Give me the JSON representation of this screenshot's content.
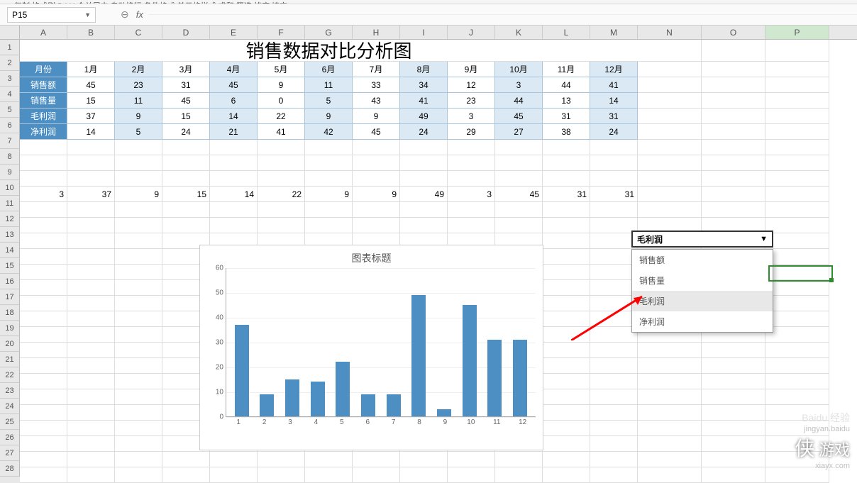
{
  "toolbar_fragments": "复制 格式刷 B I U 合并居中 自动换行 条件格式 单元格样式 求和 筛选 排序 填充",
  "name_box": "P15",
  "fx_label": "fx",
  "title": "销售数据对比分析图",
  "columns": [
    "A",
    "B",
    "C",
    "D",
    "E",
    "F",
    "G",
    "H",
    "I",
    "J",
    "K",
    "L",
    "M",
    "N",
    "O",
    "P"
  ],
  "row_labels": [
    "月份",
    "销售额",
    "销售量",
    "毛利润",
    "净利润"
  ],
  "months": [
    "1月",
    "2月",
    "3月",
    "4月",
    "5月",
    "6月",
    "7月",
    "8月",
    "9月",
    "10月",
    "11月",
    "12月"
  ],
  "data_rows": {
    "销售额": [
      45,
      23,
      31,
      45,
      9,
      11,
      33,
      34,
      12,
      3,
      44,
      41
    ],
    "销售量": [
      15,
      11,
      45,
      6,
      0,
      5,
      43,
      41,
      23,
      44,
      13,
      14
    ],
    "毛利润": [
      37,
      9,
      15,
      14,
      22,
      9,
      9,
      49,
      3,
      45,
      31,
      31
    ],
    "净利润": [
      14,
      5,
      24,
      21,
      41,
      42,
      45,
      24,
      29,
      27,
      38,
      24
    ]
  },
  "echo_row_prefix": 3,
  "echo_row": [
    37,
    9,
    15,
    14,
    22,
    9,
    9,
    49,
    3,
    45,
    31,
    31
  ],
  "dropdown": {
    "selected": "毛利润",
    "options": [
      "销售额",
      "销售量",
      "毛利润",
      "净利润"
    ],
    "highlight_index": 2
  },
  "chart_data": {
    "type": "bar",
    "title": "图表标题",
    "categories": [
      1,
      2,
      3,
      4,
      5,
      6,
      7,
      8,
      9,
      10,
      11,
      12
    ],
    "values": [
      37,
      9,
      15,
      14,
      22,
      9,
      9,
      49,
      3,
      45,
      31,
      31
    ],
    "ylim": [
      0,
      60
    ],
    "y_ticks": [
      0,
      10,
      20,
      30,
      40,
      50,
      60
    ],
    "xlabel": "",
    "ylabel": ""
  },
  "watermark": {
    "brand": "Baidu 经验",
    "site": "jingyan.baidu",
    "logo_text": "侠",
    "sub": "游戏",
    "url": "xiayx.com"
  }
}
